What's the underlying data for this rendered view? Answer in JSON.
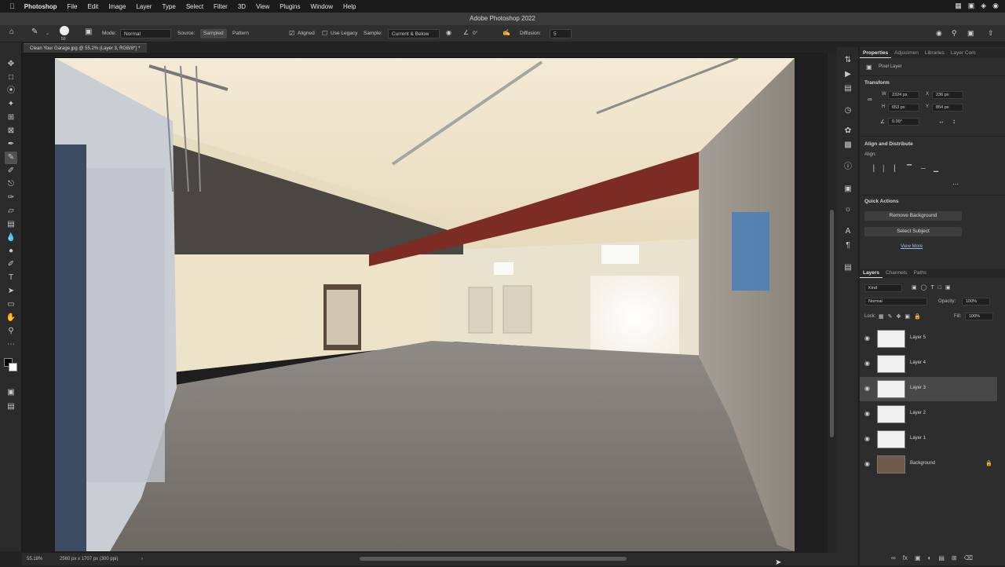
{
  "menubar": {
    "apple": "",
    "items": [
      "Photoshop",
      "File",
      "Edit",
      "Image",
      "Layer",
      "Type",
      "Select",
      "Filter",
      "3D",
      "View",
      "Plugins",
      "Window",
      "Help"
    ],
    "right_icons": [
      "control-center-icon",
      "display-icon",
      "wifi-icon",
      "user-icon"
    ]
  },
  "window": {
    "title": "Adobe Photoshop 2022"
  },
  "options": {
    "brush_size": "50",
    "mode_label": "Mode:",
    "mode_value": "Normal",
    "source_label": "Source:",
    "sampled": "Sampled",
    "pattern": "Pattern",
    "aligned": "Aligned",
    "use_legacy": "Use Legacy",
    "sample_label": "Sample:",
    "sample_value": "Current & Below",
    "angle_value": "0°",
    "diffusion_label": "Diffusion:",
    "diffusion_value": "5"
  },
  "document": {
    "tab": "Clean Your Garage.jpg @ 55.2% (Layer 3, RGB/8*) *",
    "zoom": "55.18%",
    "dimensions": "2560 px x 1707 px (300 ppi)"
  },
  "properties": {
    "tabs": [
      "Properties",
      "Adjustmen",
      "Libraries",
      "Layer Com"
    ],
    "kind": "Pixel Layer",
    "transform_title": "Transform",
    "w": "2324 px",
    "x": "236 px",
    "h": "653 px",
    "y": "854 px",
    "angle": "0.00°",
    "align_title": "Align and Distribute",
    "align_label": "Align:",
    "quick_actions_title": "Quick Actions",
    "remove_background": "Remove Background",
    "select_subject": "Select Subject",
    "view_more": "View More"
  },
  "layers": {
    "tabs": [
      "Layers",
      "Channels",
      "Paths"
    ],
    "filter": "Kind",
    "blend": "Normal",
    "opacity_label": "Opacity:",
    "opacity": "100%",
    "lock_label": "Lock:",
    "fill_label": "Fill:",
    "fill": "100%",
    "items": [
      {
        "name": "Layer 5",
        "selected": false
      },
      {
        "name": "Layer 4",
        "selected": false
      },
      {
        "name": "Layer 3",
        "selected": true
      },
      {
        "name": "Layer 2",
        "selected": false
      },
      {
        "name": "Layer 1",
        "selected": false
      },
      {
        "name": "Background",
        "selected": false,
        "locked": true
      }
    ]
  },
  "colors": {
    "accent": "#e0e0e0",
    "panel": "#2d2d2d",
    "selected_row": "#484848"
  }
}
